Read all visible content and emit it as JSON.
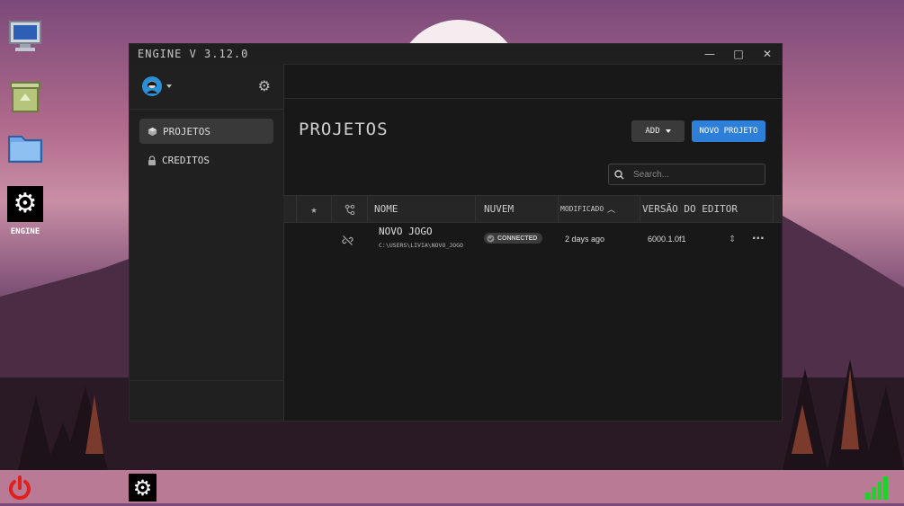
{
  "desktop": {
    "icons": [
      {
        "name": "monitor-icon"
      },
      {
        "name": "recycle-bin-icon"
      },
      {
        "name": "folder-icon"
      }
    ],
    "engine_label": "ENGINE"
  },
  "window": {
    "title": "ENGINE V 3.12.0",
    "controls": {
      "minimize": "—",
      "maximize": "□",
      "close": "✕"
    }
  },
  "sidebar": {
    "items": [
      {
        "label": "PROJETOS",
        "icon": "cube-icon",
        "active": true
      },
      {
        "label": "CREDITOS",
        "icon": "lock-icon",
        "active": false
      }
    ]
  },
  "main": {
    "title": "PROJETOS",
    "add_label": "ADD",
    "new_project_label": "NOVO PROJETO",
    "search_placeholder": "Search...",
    "columns": {
      "name": "NOME",
      "cloud": "NUVEM",
      "modified": "MODIFICADO",
      "editor_version": "VERSÃO DO EDITOR"
    },
    "projects": [
      {
        "name": "NOVO JOGO",
        "path": "C:\\USERS\\LIVIA\\NOVO_JOGO",
        "cloud_status": "CONNECTED",
        "modified": "2 days ago",
        "editor_version": "6000.1.0f1"
      }
    ]
  },
  "colors": {
    "accent": "#2d7fd8",
    "window_bg": "#181818",
    "sidebar_bg": "#202020",
    "signal": "#1fd12a",
    "power": "#e0201c"
  }
}
